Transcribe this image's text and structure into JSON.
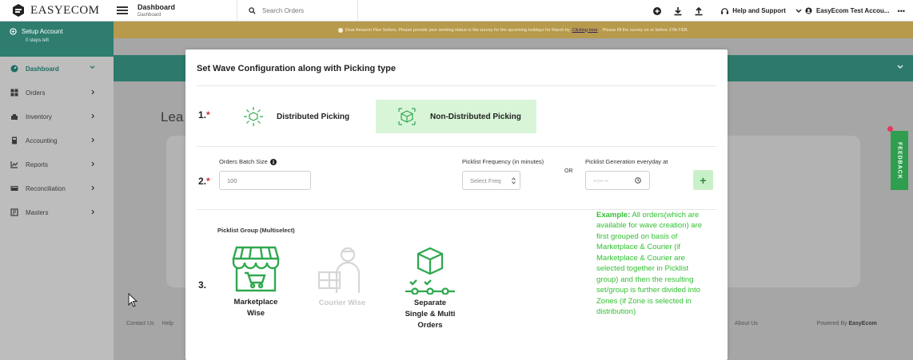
{
  "header": {
    "logo_text": "EASYECOM",
    "breadcrumb_title": "Dashboard",
    "breadcrumb_sub": "Dashboard",
    "search_placeholder": "Search Orders",
    "help_label": "Help and Support",
    "account_label": "EasyEcom Test Accou...",
    "more_label": "•••"
  },
  "sidebar": {
    "setup_title": "Setup Account",
    "setup_sub": "0 steps left",
    "items": [
      {
        "label": "Dashboard",
        "icon": "dashboard-icon"
      },
      {
        "label": "Orders",
        "icon": "orders-icon"
      },
      {
        "label": "Inventory",
        "icon": "inventory-icon"
      },
      {
        "label": "Accounting",
        "icon": "accounting-icon"
      },
      {
        "label": "Reports",
        "icon": "reports-icon"
      },
      {
        "label": "Reconciliation",
        "icon": "reconciliation-icon"
      },
      {
        "label": "Masters",
        "icon": "masters-icon"
      }
    ]
  },
  "banner": {
    "text_before": "Dear Amazon Flex Sellers, Please provide your working status in the survey for the upcoming holidays for March by",
    "link": "Clicking here",
    "text_after": ". Please fill the survey on or before 27th FEB."
  },
  "background": {
    "title": "Lea",
    "footer_left": [
      "Contact Us",
      "Help"
    ],
    "footer_about": "About Us",
    "footer_powered": "Powered By",
    "footer_brand": "EasyEcom",
    "feedback": "FEEDBACK"
  },
  "modal": {
    "title": "Set Wave Configuration along with Picking type",
    "step1": "1.",
    "step2": "2.",
    "step3": "3.",
    "required_mark": "*",
    "picking": {
      "distributed": "Distributed Picking",
      "non_distributed": "Non-Distributed Picking",
      "selected": "Non-Distributed Picking"
    },
    "batch_size_label": "Orders Batch Size",
    "batch_size_placeholder": "100",
    "frequency_label": "Picklist Frequency (in minutes)",
    "frequency_placeholder": "Select Freq",
    "or_label": "OR",
    "generation_label": "Picklist Generation everyday at",
    "generation_placeholder": "--:-- --",
    "add_label": "+",
    "group_label": "Picklist Group (Multiselect)",
    "groups": [
      {
        "line1": "Marketplace",
        "line2": "Wise",
        "line3": "",
        "enabled": true
      },
      {
        "line1": "Courier Wise",
        "line2": "",
        "line3": "",
        "enabled": false
      },
      {
        "line1": "Separate",
        "line2": "Single & Multi",
        "line3": "Orders",
        "enabled": true
      }
    ],
    "example_title": "Example:",
    "example_text": " All orders(which are available for wave creation) are first grouped on basis of Marketplace & Courier (if Marketplace & Courier are selected together in Picklist group) and then the resulting set/group is further divided into Zones (if Zone is selected in distribution)"
  },
  "colors": {
    "brand_green": "#2e7d6f",
    "selected_bg": "#d8f5d8",
    "example_green": "#32c032",
    "required_red": "#d32f2f"
  }
}
